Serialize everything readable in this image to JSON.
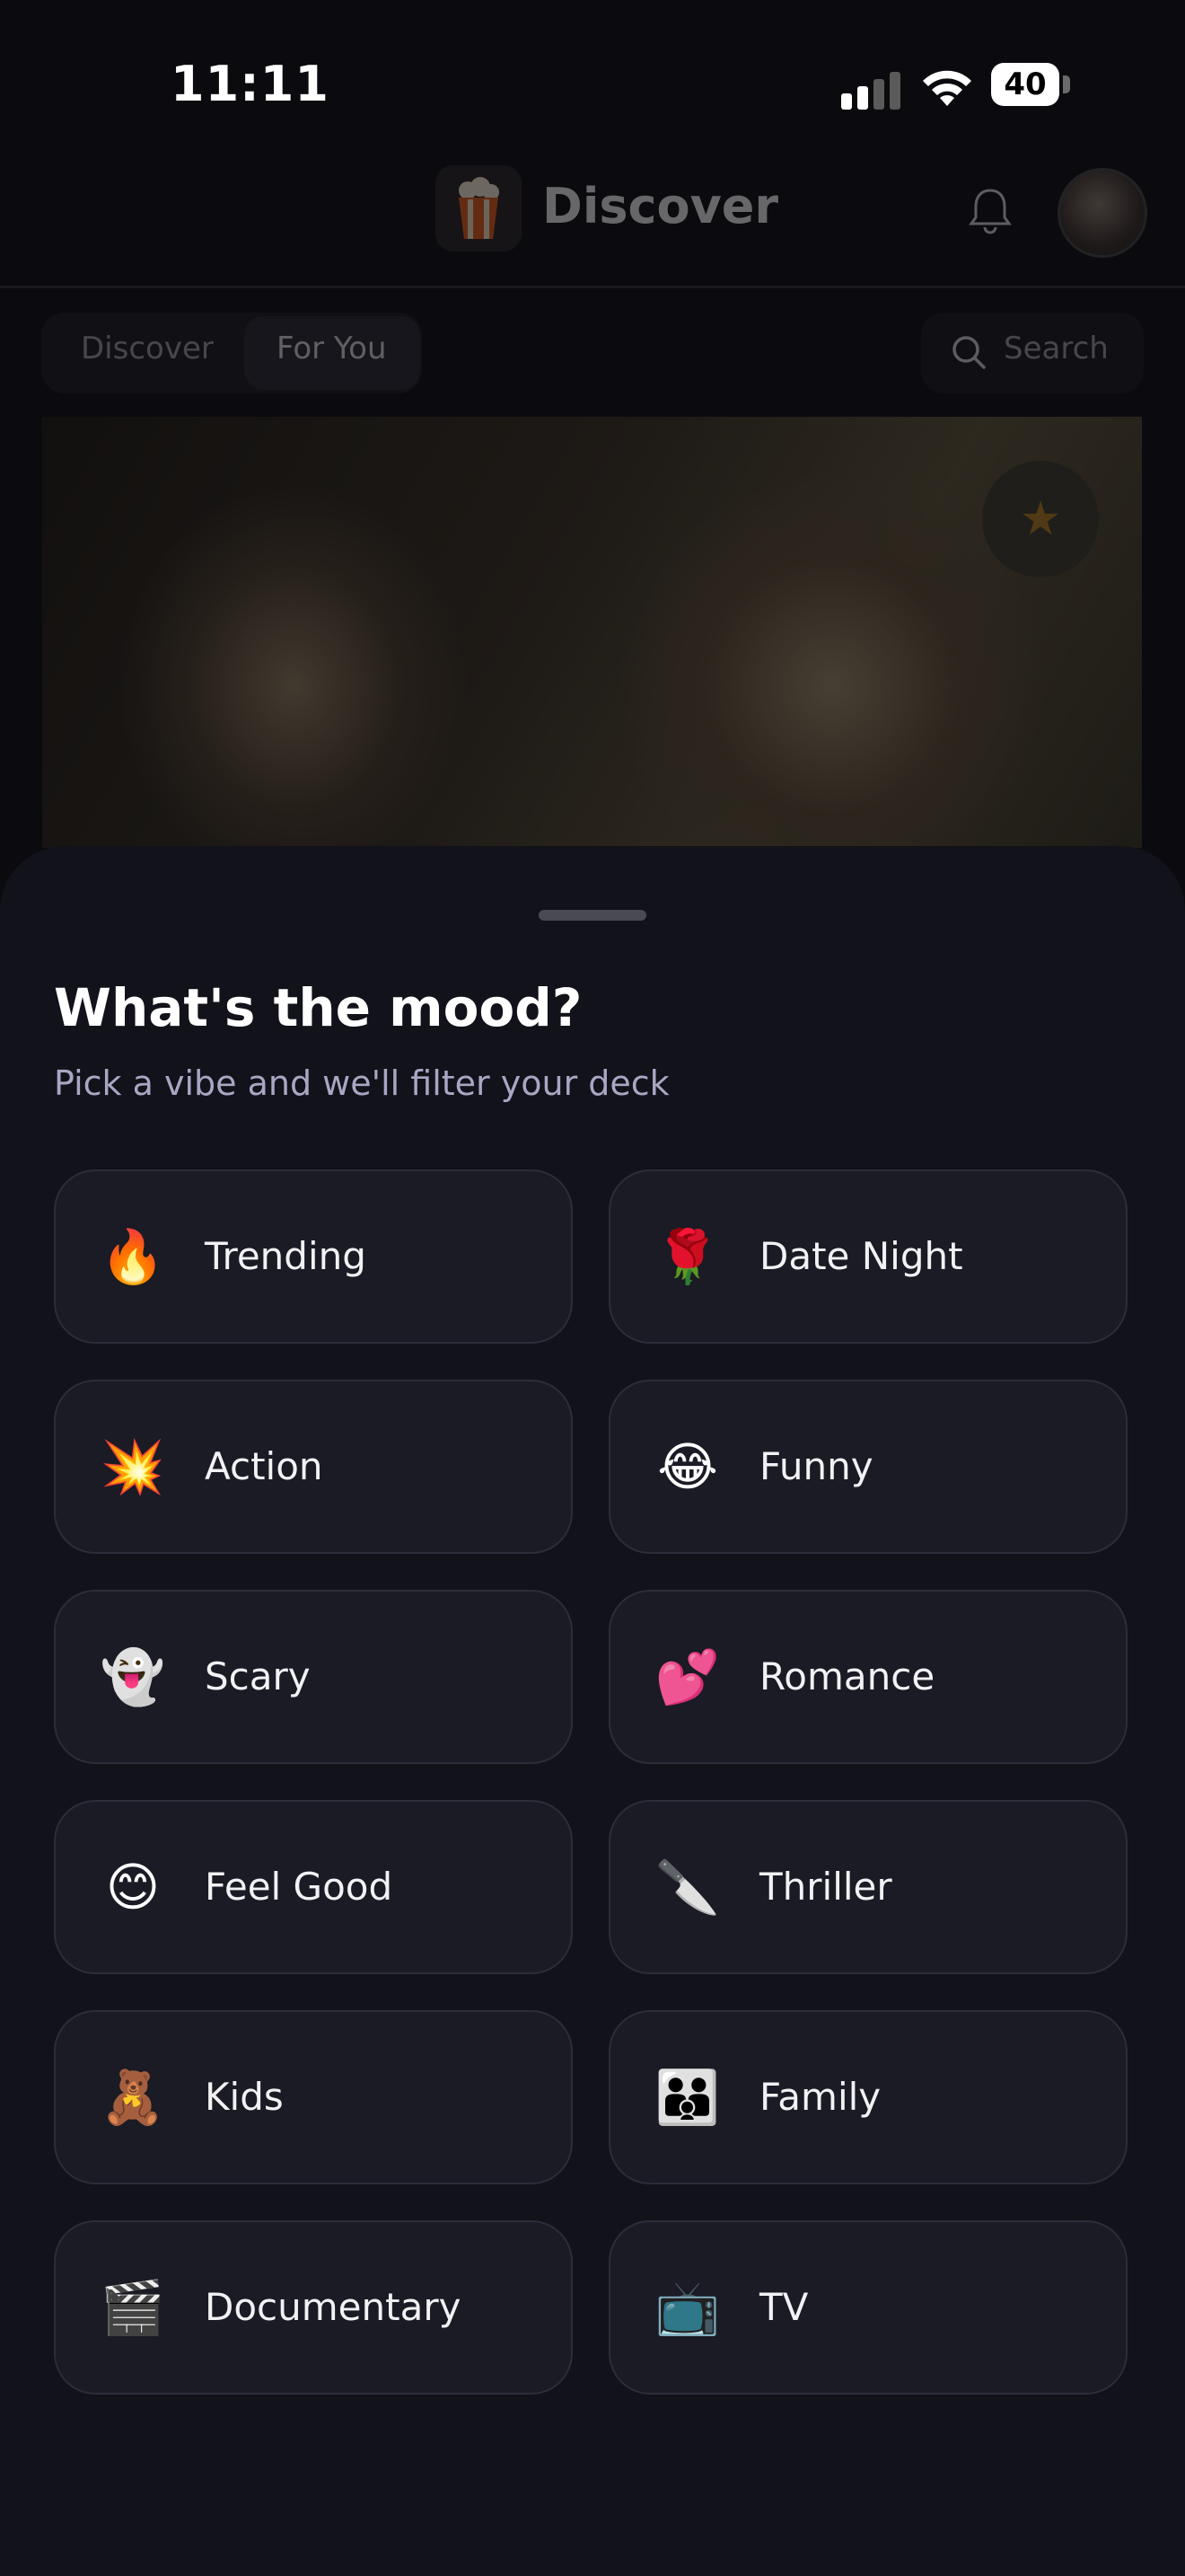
{
  "status_bar": {
    "time": "11:11",
    "battery": "40"
  },
  "header": {
    "title": "Discover",
    "logo_icon": "popcorn-icon"
  },
  "tabs": [
    {
      "label": "Discover",
      "active": false
    },
    {
      "label": "For You",
      "active": true
    }
  ],
  "search": {
    "label": "Search"
  },
  "sheet": {
    "title": "What's the mood?",
    "subtitle": "Pick a vibe and we'll filter your deck",
    "moods": [
      {
        "emoji": "🔥",
        "label": "Trending"
      },
      {
        "emoji": "🌹",
        "label": "Date Night"
      },
      {
        "emoji": "💥",
        "label": "Action"
      },
      {
        "emoji": "😂",
        "label": "Funny"
      },
      {
        "emoji": "👻",
        "label": "Scary"
      },
      {
        "emoji": "💕",
        "label": "Romance"
      },
      {
        "emoji": "😊",
        "label": "Feel Good"
      },
      {
        "emoji": "🔪",
        "label": "Thriller"
      },
      {
        "emoji": "🧸",
        "label": "Kids"
      },
      {
        "emoji": "👪",
        "label": "Family"
      },
      {
        "emoji": "🎬",
        "label": "Documentary"
      },
      {
        "emoji": "📺",
        "label": "TV"
      }
    ]
  },
  "colors": {
    "sheet_bg": "#11121a",
    "card_bg": "#1a1b24",
    "subtitle": "#a9a6c4"
  }
}
